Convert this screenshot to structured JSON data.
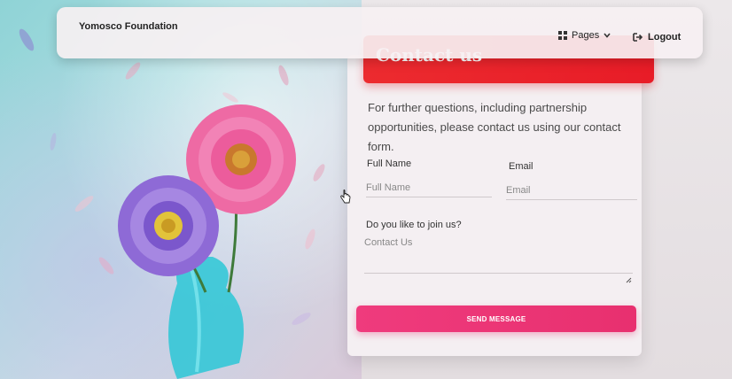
{
  "navbar": {
    "brand": "Yomosco Foundation",
    "pages_label": "Pages",
    "logout_label": "Logout",
    "icons": {
      "pages": "grid-icon",
      "dropdown": "chevron-down-icon",
      "logout": "sign-out-icon"
    }
  },
  "card": {
    "title": "Contact us",
    "intro": "For further questions, including partnership opportunities, please contact us using our contact form.",
    "form": {
      "full_name_label": "Full Name",
      "full_name_placeholder": "Full Name",
      "email_label": "Email",
      "email_placeholder": "Email",
      "join_label": "Do you like to join us?",
      "message_placeholder": "Contact Us",
      "submit_label": "SEND MESSAGE"
    }
  },
  "colors": {
    "header_red": "#e81c27",
    "button_pink": "#e8306f"
  }
}
